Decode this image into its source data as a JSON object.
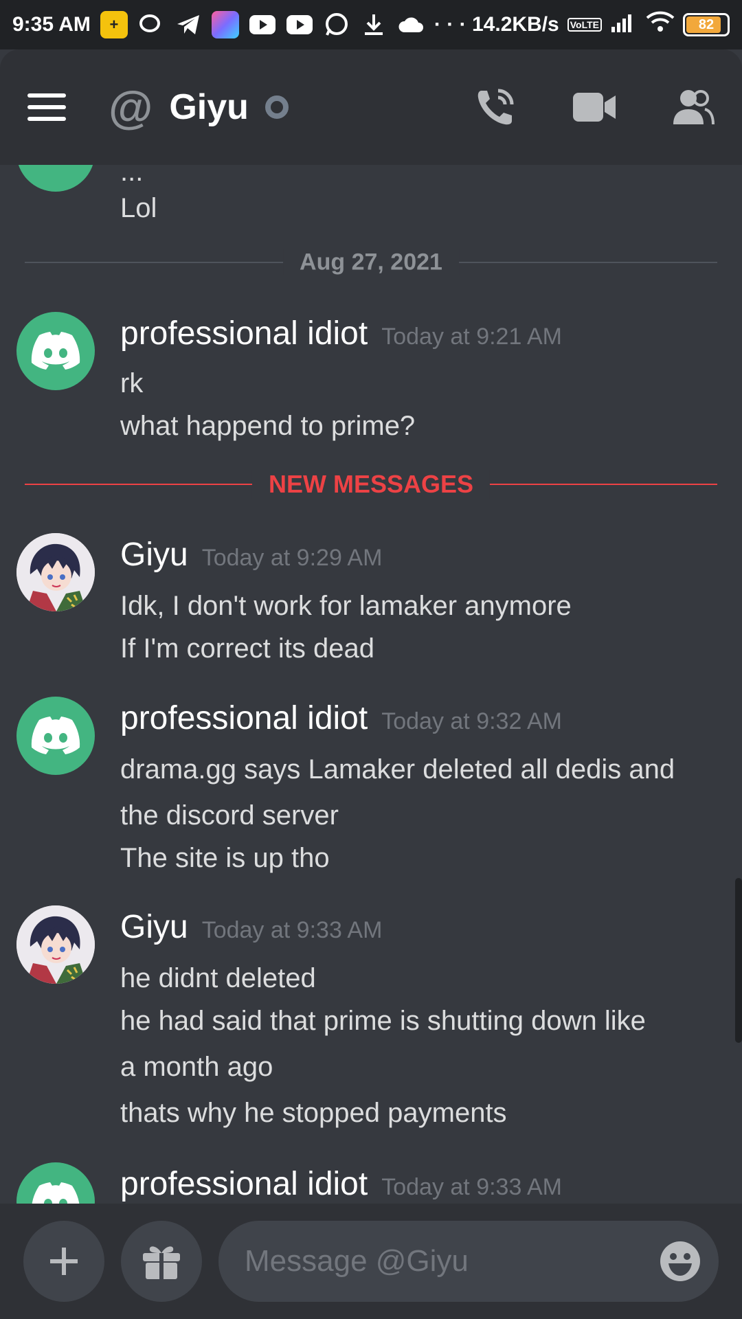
{
  "status_bar": {
    "time": "9:35 AM",
    "net_speed": "14.2KB/s",
    "battery": "82",
    "dots": "· · ·"
  },
  "header": {
    "at_symbol": "@",
    "title": "Giyu",
    "icons": [
      "menu-icon",
      "call-icon",
      "video-icon",
      "members-icon"
    ]
  },
  "chat": {
    "prev_lines": [
      "...",
      "Lol"
    ],
    "date_divider": "Aug 27, 2021",
    "new_messages_label": "NEW MESSAGES",
    "messages": [
      {
        "author": "professional idiot",
        "time": "Today at 9:21 AM",
        "lines": [
          "rk",
          "what happend to prime?"
        ]
      },
      {
        "author": "Giyu",
        "time": "Today at 9:29 AM",
        "lines": [
          "Idk, I don't work for lamaker anymore",
          "If I'm correct its dead"
        ]
      },
      {
        "author": "professional idiot",
        "time": "Today at 9:32 AM",
        "lines": [
          "drama.gg says Lamaker deleted all dedis and",
          "the discord server",
          "The site is up tho"
        ]
      },
      {
        "author": "Giyu",
        "time": "Today at 9:33 AM",
        "lines": [
          "he didnt deleted",
          "he had said that prime is shutting down like",
          "a month ago",
          "thats why he stopped payments"
        ]
      },
      {
        "author": "professional idiot",
        "time": "Today at 9:33 AM",
        "lines": []
      }
    ]
  },
  "composer": {
    "placeholder": "Message @Giyu",
    "value": ""
  },
  "colors": {
    "background": "#36393f",
    "header": "#2f3136",
    "discord_green": "#43b581",
    "new_messages": "#ed4245"
  }
}
